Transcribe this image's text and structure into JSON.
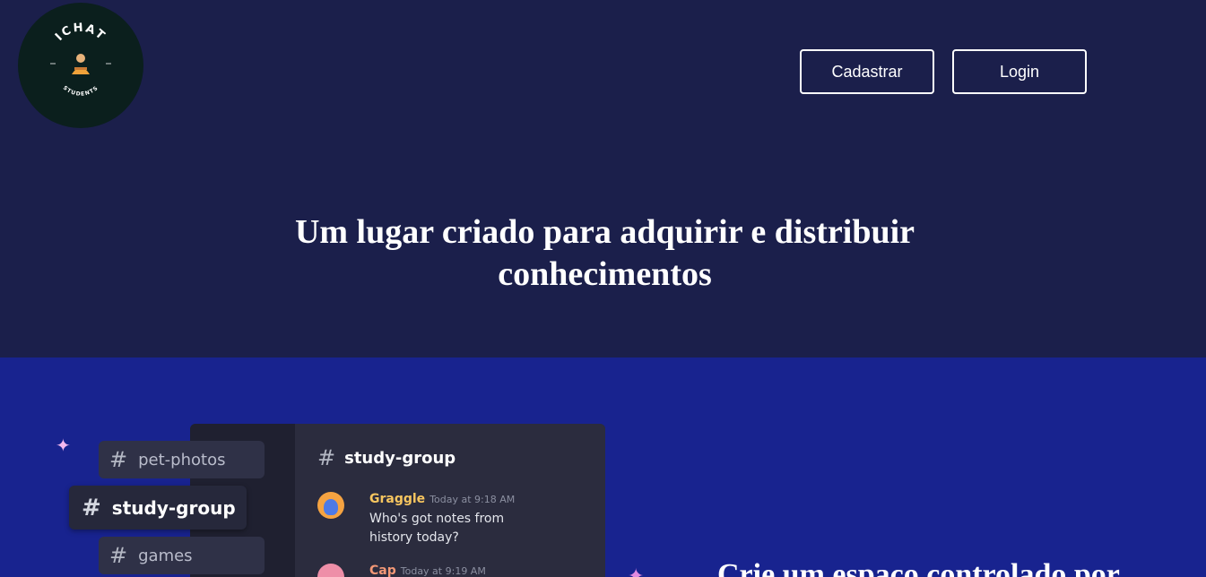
{
  "logo": {
    "brand_text": "ICHAT",
    "sub_text": "STUDENTS"
  },
  "header": {
    "cadastrar_label": "Cadastrar",
    "login_label": "Login"
  },
  "hero": {
    "headline": "Um lugar criado para adquirir e distribuir conhecimentos"
  },
  "illustration": {
    "channels": [
      {
        "name": "pet-photos"
      },
      {
        "name": "study-group"
      },
      {
        "name": "games"
      }
    ],
    "chat": {
      "channel_name": "study-group",
      "messages": [
        {
          "author": "Graggle",
          "time": "Today at 9:18 AM",
          "text": "Who's got notes from history today?"
        },
        {
          "author": "Cap",
          "time": "Today at 9:19 AM",
          "text": ""
        }
      ]
    }
  },
  "feature": {
    "title": "Crie um espaço controlado por"
  },
  "colors": {
    "hero_bg": "#1b1f4b",
    "feature_bg": "#18238f",
    "logo_bg": "#0b1f1d"
  }
}
